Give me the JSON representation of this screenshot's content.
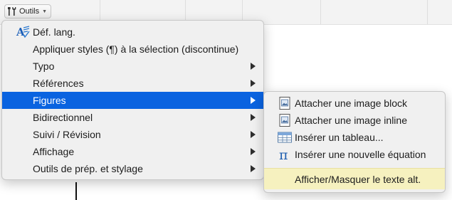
{
  "toolbar": {
    "tools_label": "Outils"
  },
  "main_menu": {
    "items": [
      {
        "label": "Déf. lang.",
        "has_submenu": false,
        "icon": "spellcheck-icon"
      },
      {
        "label": "Appliquer styles (¶) à la sélection (discontinue)",
        "has_submenu": false
      },
      {
        "label": "Typo",
        "has_submenu": true
      },
      {
        "label": "Références",
        "has_submenu": true
      },
      {
        "label": "Figures",
        "has_submenu": true,
        "highlighted": true
      },
      {
        "label": "Bidirectionnel",
        "has_submenu": true
      },
      {
        "label": "Suivi / Révision",
        "has_submenu": true
      },
      {
        "label": "Affichage",
        "has_submenu": true
      },
      {
        "label": "Outils de prép. et stylage",
        "has_submenu": true
      }
    ]
  },
  "figures_submenu": {
    "items": [
      {
        "label": "Attacher une image block",
        "icon": "image-block-icon"
      },
      {
        "label": "Attacher une image inline",
        "icon": "image-inline-icon"
      },
      {
        "label": "Insérer un tableau...",
        "icon": "table-icon"
      },
      {
        "label": "Insérer une nouvelle équation",
        "icon": "pi-icon"
      },
      {
        "label": "Afficher/Masquer le texte alt."
      }
    ]
  },
  "colors": {
    "highlight": "#0a63e0",
    "alt_toggle_background": "#f6f1bf"
  }
}
